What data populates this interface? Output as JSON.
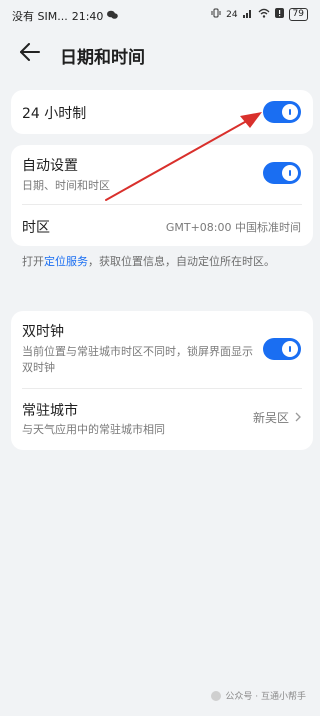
{
  "status_bar": {
    "carrier": "没有 SIM...",
    "time": "21:40",
    "network": "24",
    "battery": "79"
  },
  "header": {
    "title": "日期和时间"
  },
  "clock24": {
    "label": "24 小时制",
    "enabled": true
  },
  "auto": {
    "label": "自动设置",
    "sub": "日期、时间和时区",
    "enabled": true,
    "timezone_label": "时区",
    "timezone_value": "GMT+08:00 中国标准时间"
  },
  "note": {
    "prefix": "打开",
    "link": "定位服务",
    "suffix": "，获取位置信息，自动定位所在时区。"
  },
  "dual_clock": {
    "label": "双时钟",
    "sub": "当前位置与常驻城市时区不同时，锁屏界面显示双时钟",
    "enabled": true
  },
  "home_city": {
    "label": "常驻城市",
    "sub": "与天气应用中的常驻城市相同",
    "value": "新吴区"
  },
  "watermark": {
    "text": "公众号 · 互通小帮手"
  },
  "colors": {
    "accent": "#1a6ef2",
    "arrow": "#d9302c",
    "background": "#f1f3f5"
  }
}
